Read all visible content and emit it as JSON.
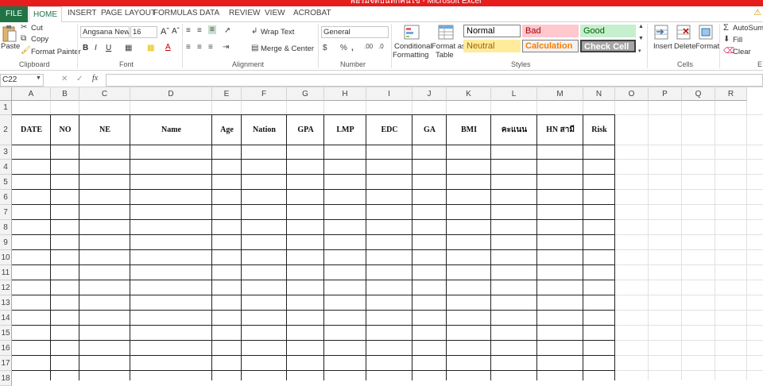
{
  "window": {
    "title": "ฟอร์มจดบันทึกคนไข้ - Microsoft Excel"
  },
  "tabs": [
    "FILE",
    "HOME",
    "INSERT",
    "PAGE LAYOUT",
    "FORMULAS",
    "DATA",
    "REVIEW",
    "VIEW",
    "ACROBAT"
  ],
  "clipboard": {
    "paste": "Paste",
    "cut": "Cut",
    "copy": "Copy",
    "format_painter": "Format Painter",
    "label": "Clipboard"
  },
  "font": {
    "name": "Angsana New",
    "size": "16",
    "label": "Font"
  },
  "alignment": {
    "wrap": "Wrap Text",
    "merge": "Merge & Center",
    "label": "Alignment"
  },
  "number": {
    "format": "General",
    "label": "Number"
  },
  "styles": {
    "conditional": [
      "Conditional",
      "Formatting"
    ],
    "format_table": [
      "Format as",
      "Table"
    ],
    "items": [
      {
        "label": "Normal",
        "bg": "#ffffff",
        "fg": "#000000",
        "border": "#7f7f7f"
      },
      {
        "label": "Bad",
        "bg": "#ffc7ce",
        "fg": "#9c0006",
        "border": "#ffc7ce"
      },
      {
        "label": "Good",
        "bg": "#c6efce",
        "fg": "#006100",
        "border": "#c6efce"
      },
      {
        "label": "Neutral",
        "bg": "#ffeb9c",
        "fg": "#9c6500",
        "border": "#ffeb9c"
      },
      {
        "label": "Calculation",
        "bg": "#f2f2f2",
        "fg": "#fa7d00",
        "border": "#7f7f7f"
      },
      {
        "label": "Check Cell",
        "bg": "#a5a5a5",
        "fg": "#ffffff",
        "border": "#3f3f3f"
      }
    ],
    "label": "Styles"
  },
  "cells": {
    "insert": "Insert",
    "delete": "Delete",
    "format": "Format",
    "label": "Cells"
  },
  "editing": {
    "autosum": "AutoSum",
    "fill": "Fill",
    "clear": "Clear",
    "label": "E"
  },
  "formula_bar": {
    "cell_ref": "C22",
    "formula": ""
  },
  "columns": [
    "A",
    "B",
    "C",
    "D",
    "E",
    "F",
    "G",
    "H",
    "I",
    "J",
    "K",
    "L",
    "M",
    "N",
    "O",
    "P",
    "Q",
    "R"
  ],
  "rows": [
    "1",
    "2",
    "3",
    "4",
    "5",
    "6",
    "7",
    "8",
    "9",
    "10",
    "11",
    "12",
    "13",
    "14",
    "15",
    "16",
    "17",
    "18"
  ],
  "table_headers": [
    "DATE",
    "NO",
    "NE",
    "Name",
    "Age",
    "Nation",
    "GPA",
    "LMP",
    "EDC",
    "GA",
    "BMI",
    "คะแนน",
    "HN สามี",
    "Risk"
  ]
}
